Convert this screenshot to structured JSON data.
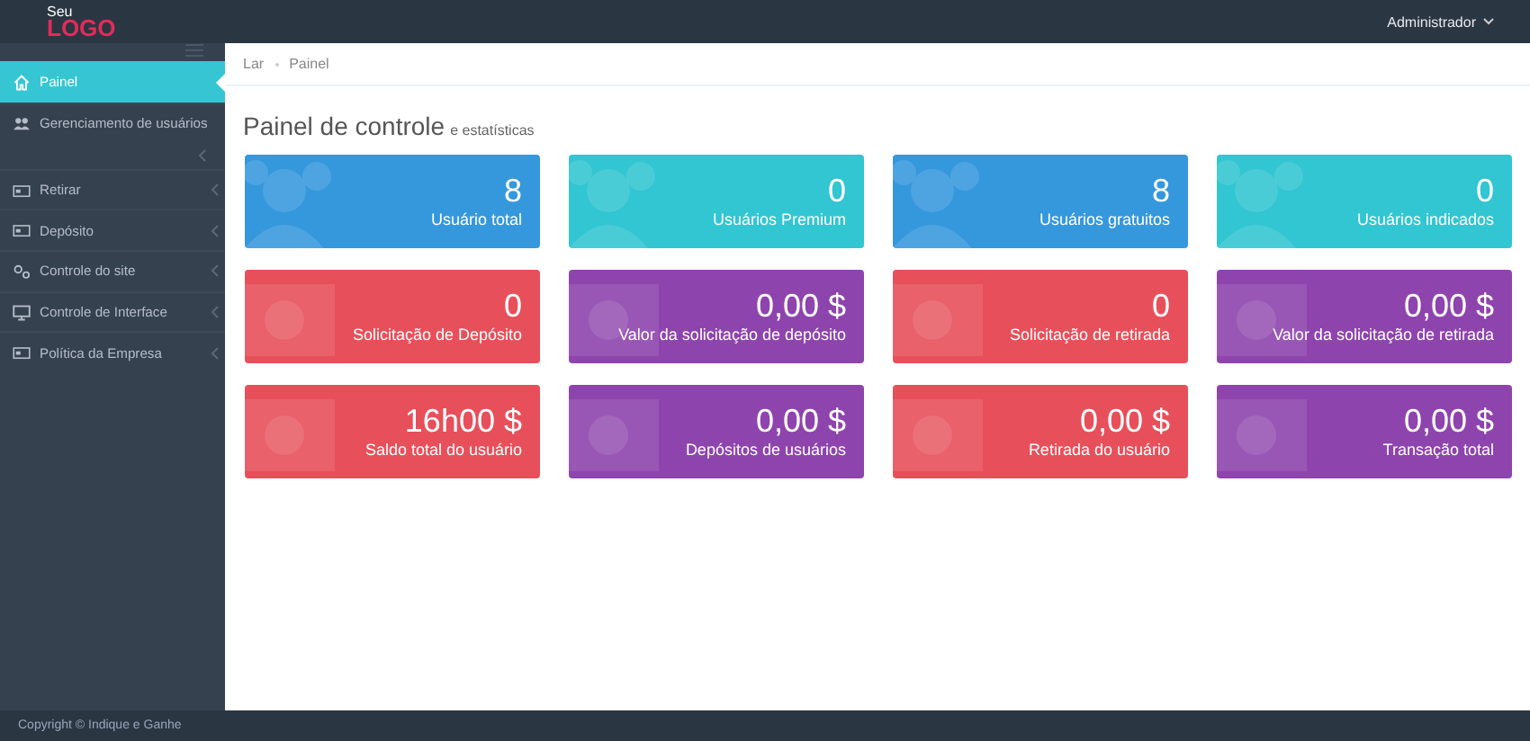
{
  "logo": {
    "small": "Seu",
    "big": "LOGO"
  },
  "user_menu": {
    "label": "Administrador"
  },
  "sidebar": {
    "items": [
      {
        "label": "Painel",
        "kind": "home",
        "selected": true,
        "expandable": false
      },
      {
        "label": "Gerenciamento de usuários",
        "kind": "users",
        "selected": false,
        "expandable": true
      },
      {
        "label": "Retirar",
        "kind": "card",
        "selected": false,
        "expandable": true
      },
      {
        "label": "Depósito",
        "kind": "card",
        "selected": false,
        "expandable": true
      },
      {
        "label": "Controle do site",
        "kind": "gear",
        "selected": false,
        "expandable": true
      },
      {
        "label": "Controle de Interface",
        "kind": "monitor",
        "selected": false,
        "expandable": true
      },
      {
        "label": "Política da Empresa",
        "kind": "card",
        "selected": false,
        "expandable": true
      }
    ]
  },
  "breadcrumb": [
    "Lar",
    "Painel"
  ],
  "page_title": {
    "title": "Painel de controle",
    "subtitle": "e estatísticas"
  },
  "cards": [
    {
      "kind": "users",
      "color": "#3598dc",
      "value": "8",
      "label": "Usuário total"
    },
    {
      "kind": "users",
      "color": "#32c5d2",
      "value": "0",
      "label": "Usuários Premium"
    },
    {
      "kind": "users",
      "color": "#3598dc",
      "value": "8",
      "label": "Usuários gratuitos"
    },
    {
      "kind": "users",
      "color": "#32c5d2",
      "value": "0",
      "label": "Usuários indicados"
    },
    {
      "kind": "money",
      "color": "#e7505a",
      "value": "0",
      "label": "Solicitação de Depósito"
    },
    {
      "kind": "money",
      "color": "#8e44ad",
      "value": "0,00 $",
      "label": "Valor da solicitação de depósito"
    },
    {
      "kind": "money",
      "color": "#e7505a",
      "value": "0",
      "label": "Solicitação de retirada"
    },
    {
      "kind": "money",
      "color": "#8e44ad",
      "value": "0,00 $",
      "label": "Valor da solicitação de retirada"
    },
    {
      "kind": "money",
      "color": "#e7505a",
      "value": "16h00 $",
      "label": "Saldo total do usuário"
    },
    {
      "kind": "money",
      "color": "#8e44ad",
      "value": "0,00 $",
      "label": "Depósitos de usuários"
    },
    {
      "kind": "money",
      "color": "#e7505a",
      "value": "0,00 $",
      "label": "Retirada do usuário"
    },
    {
      "kind": "money",
      "color": "#8e44ad",
      "value": "0,00 $",
      "label": "Transação total"
    }
  ],
  "footer": "Copyright © Indique e Ganhe"
}
